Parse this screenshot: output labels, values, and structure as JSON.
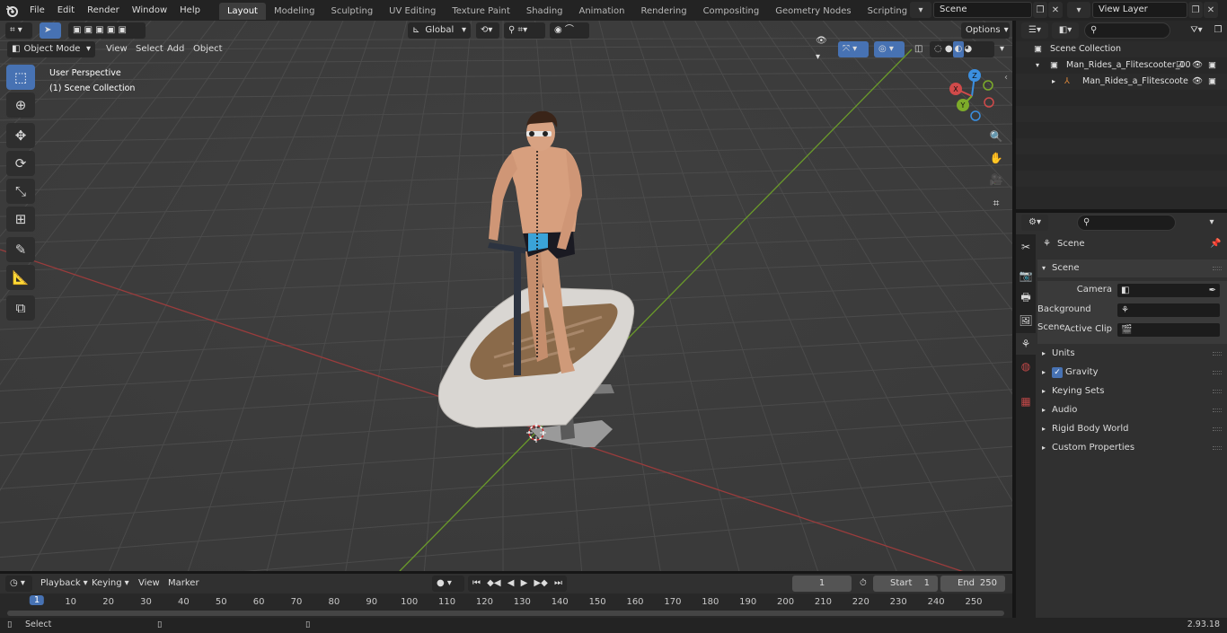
{
  "topbar": {
    "menus": [
      "File",
      "Edit",
      "Render",
      "Window",
      "Help"
    ],
    "workspaces": [
      "Layout",
      "Modeling",
      "Sculpting",
      "UV Editing",
      "Texture Paint",
      "Shading",
      "Animation",
      "Rendering",
      "Compositing",
      "Geometry Nodes",
      "Scripting"
    ],
    "active_workspace": "Layout",
    "add_tab": "+",
    "scene_name": "Scene",
    "view_layer": "View Layer"
  },
  "viewport": {
    "mode": "Object Mode",
    "menus": [
      "View",
      "Select",
      "Add",
      "Object"
    ],
    "transform_orientation": "Global",
    "options_label": "Options",
    "overlay_line1": "User Perspective",
    "overlay_line2": "(1) Scene Collection",
    "gizmo": {
      "x": "X",
      "y": "Y",
      "z": "Z"
    },
    "tools": [
      "select-box-tool",
      "cursor-tool",
      "move-tool",
      "rotate-tool",
      "scale-tool",
      "transform-tool",
      "annotate-tool",
      "measure-tool",
      "add-cube-tool"
    ],
    "active_tool": "select-box-tool"
  },
  "timeline": {
    "menus": [
      "Playback",
      "Keying",
      "View",
      "Marker"
    ],
    "current_frame": "1",
    "start_label": "Start",
    "start_value": "1",
    "end_label": "End",
    "end_value": "250",
    "ruler": [
      "1",
      "10",
      "20",
      "30",
      "40",
      "50",
      "60",
      "70",
      "80",
      "90",
      "100",
      "110",
      "120",
      "130",
      "140",
      "150",
      "160",
      "170",
      "180",
      "190",
      "200",
      "210",
      "220",
      "230",
      "240",
      "250"
    ]
  },
  "status": {
    "left_label": "Select",
    "version": "2.93.18"
  },
  "outliner": {
    "root": "Scene Collection",
    "items": [
      {
        "label": "Man_Rides_a_Flitescooter_00",
        "depth": 1
      },
      {
        "label": "Man_Rides_a_Flitescoote",
        "depth": 2
      }
    ]
  },
  "properties": {
    "context_title": "Scene",
    "panel_title": "Scene",
    "fields": [
      {
        "label": "Camera"
      },
      {
        "label": "Background Scene"
      },
      {
        "label": "Active Clip"
      }
    ],
    "sections": [
      "Units",
      "Gravity",
      "Keying Sets",
      "Audio",
      "Rigid Body World",
      "Custom Properties"
    ],
    "gravity_checked": true
  },
  "colors": {
    "accent": "#4772b3",
    "x_axis": "#d04a4a",
    "y_axis": "#7dab2a",
    "z_axis": "#3b8fe0",
    "viewport_bg": "#3d3d3d"
  }
}
